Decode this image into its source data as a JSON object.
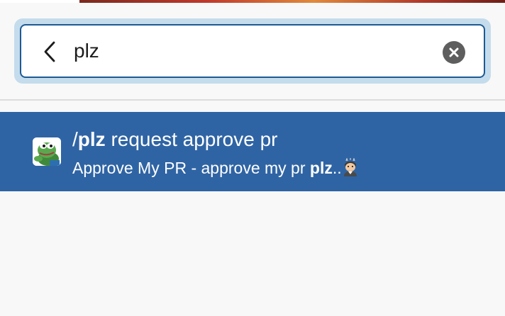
{
  "search": {
    "value": "plz",
    "placeholder": ""
  },
  "results": [
    {
      "command_prefix": "/",
      "command_name": "plz",
      "command_args": " request approve pr",
      "description_prefix": "Approve My PR - approve my pr ",
      "description_bold": "plz",
      "description_suffix": "..",
      "icon": "pepe-frog-icon",
      "trailing_icon": "dizzy-face-emoji-icon"
    }
  ],
  "colors": {
    "selected_row": "#2f64a4",
    "search_border": "#1d5a94",
    "search_focus_ring": "#c4dcec",
    "clear_button": "#5e5e5e"
  }
}
